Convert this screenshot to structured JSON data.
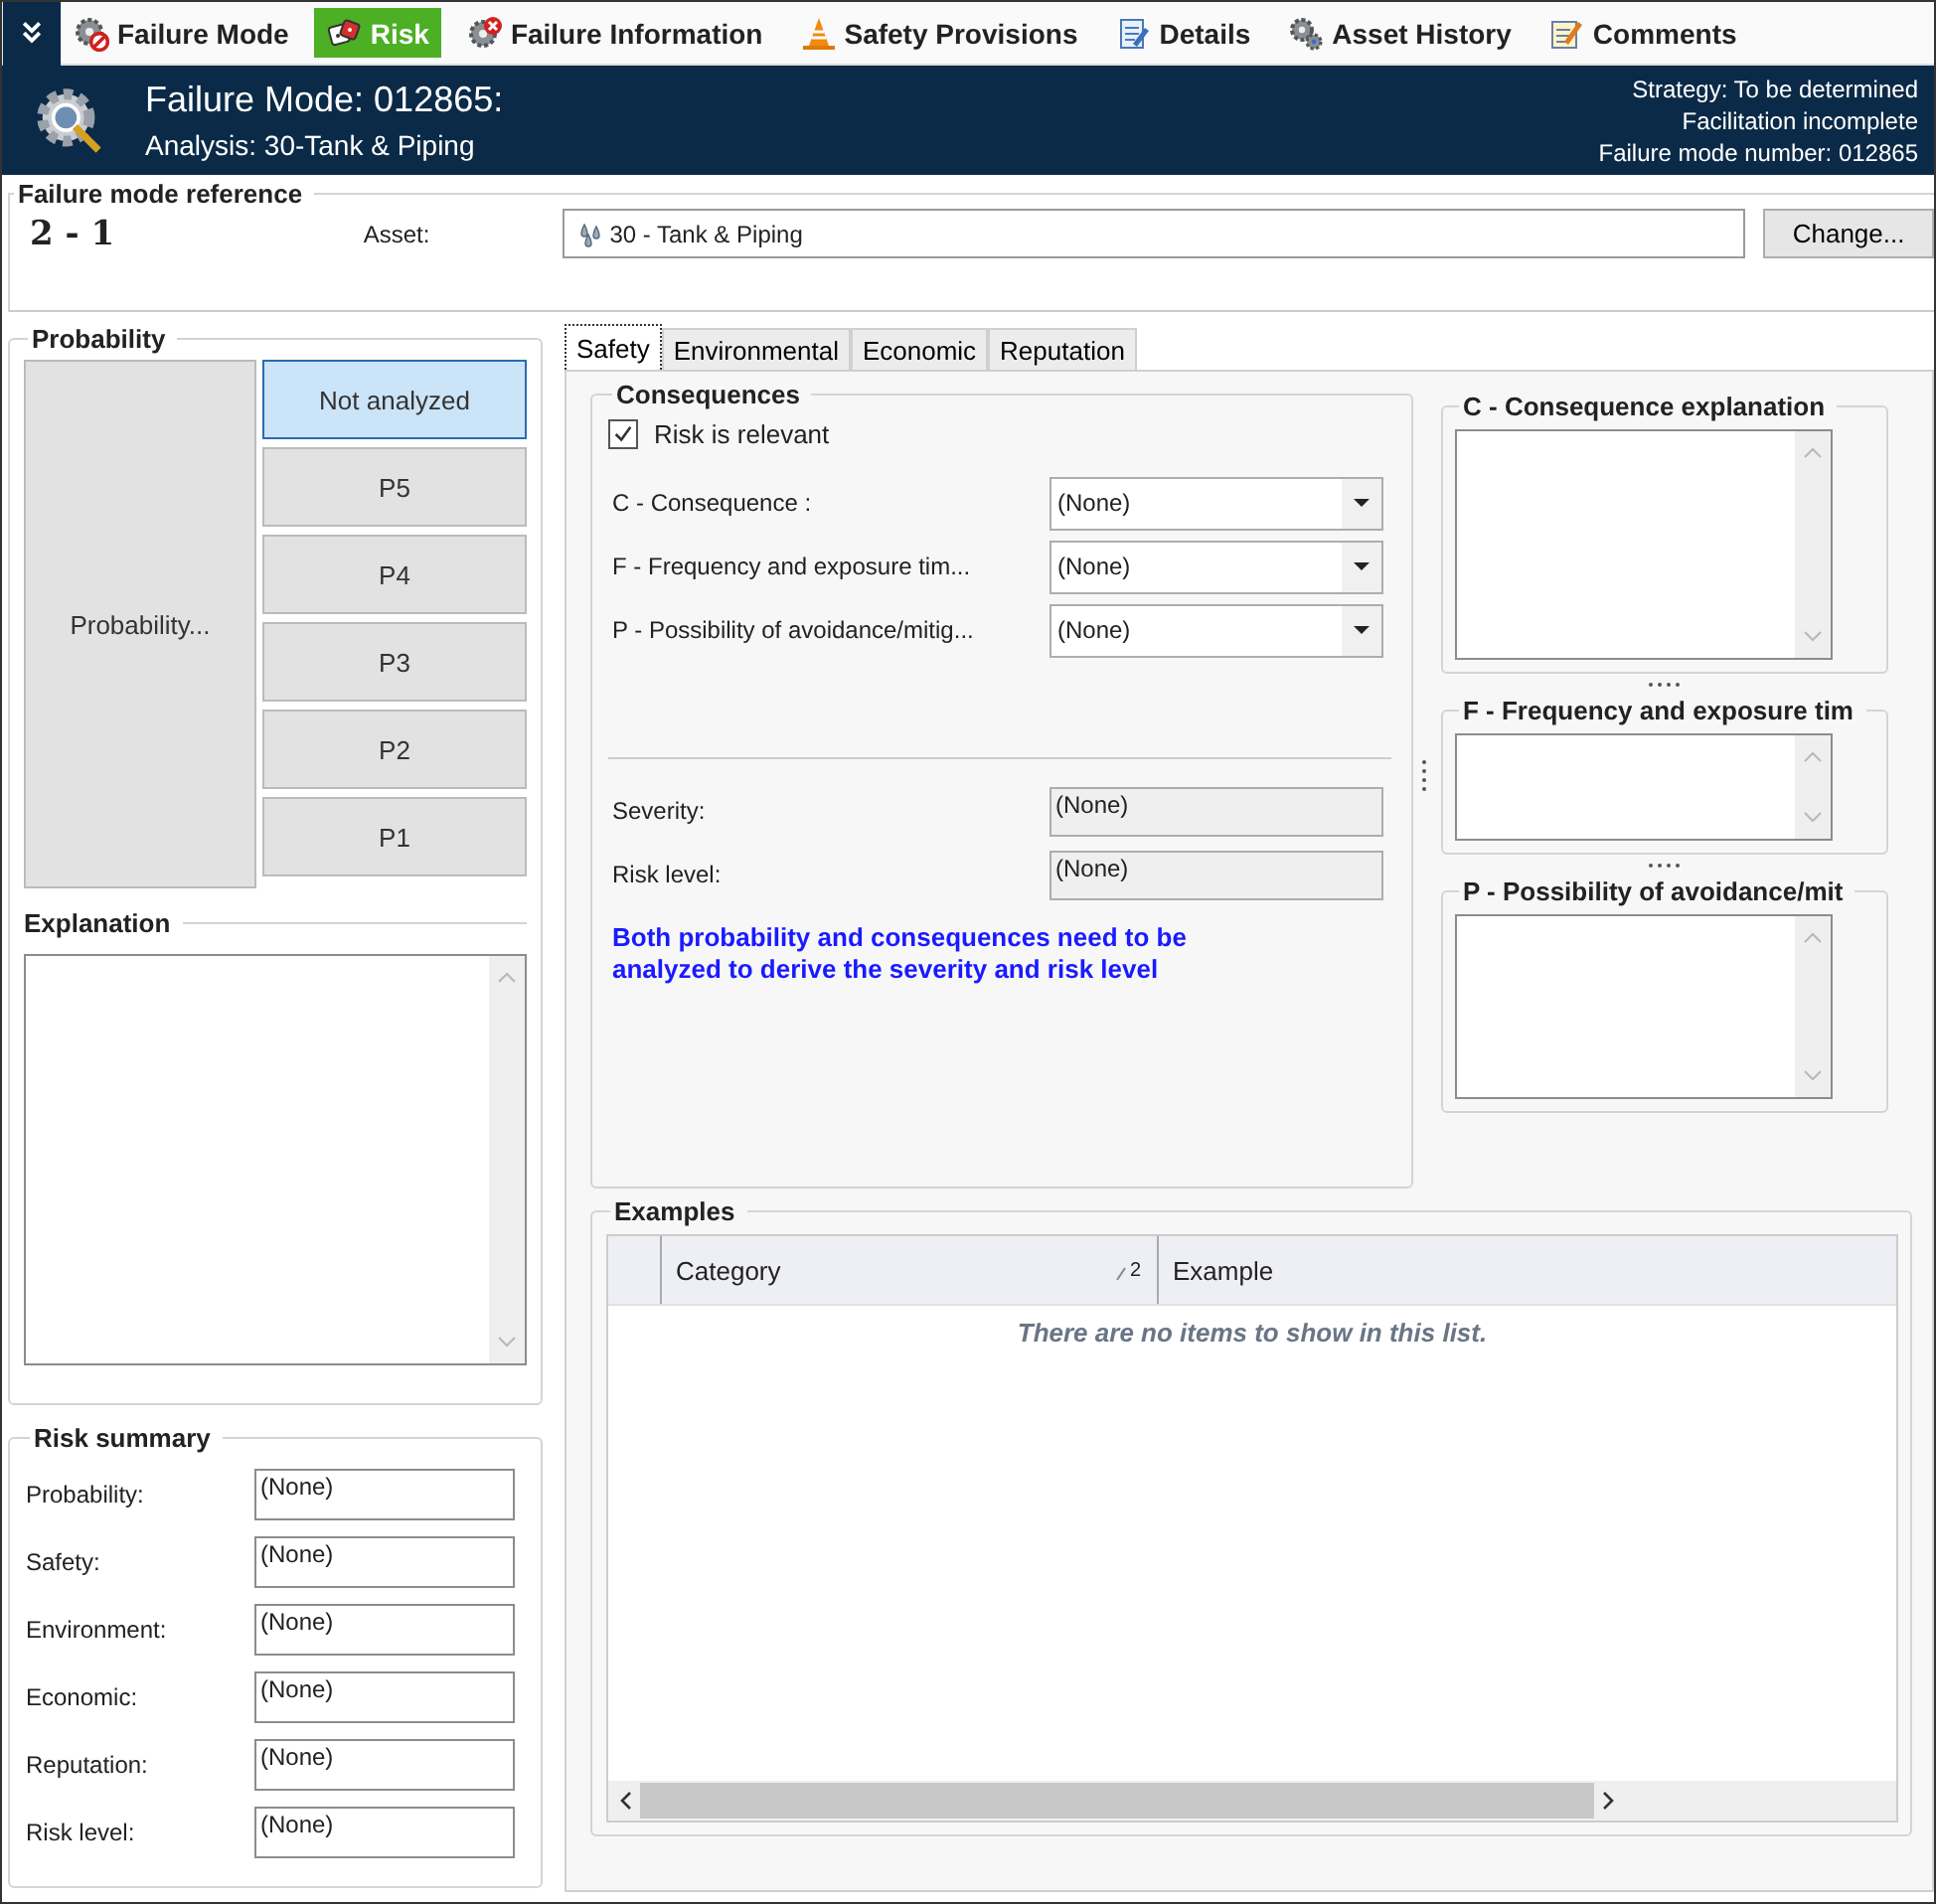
{
  "toolbar": {
    "tabs": [
      {
        "label": "Failure Mode",
        "selected": false
      },
      {
        "label": "Risk",
        "selected": true
      },
      {
        "label": "Failure Information",
        "selected": false
      },
      {
        "label": "Safety Provisions",
        "selected": false
      },
      {
        "label": "Details",
        "selected": false
      },
      {
        "label": "Asset History",
        "selected": false
      },
      {
        "label": "Comments",
        "selected": false
      }
    ]
  },
  "header": {
    "title": "Failure Mode: 012865:",
    "subtitle": "Analysis: 30-Tank & Piping",
    "status_lines": [
      "Strategy: To be determined",
      "Facilitation incomplete",
      "Failure mode number: 012865"
    ]
  },
  "reference": {
    "title": "Failure mode reference",
    "number": "2 - 1",
    "asset_label": "Asset:",
    "asset_value": "30 - Tank & Piping",
    "change_button": "Change..."
  },
  "probability": {
    "title": "Probability",
    "main_button": "Probability...",
    "levels": [
      {
        "label": "Not analyzed",
        "selected": true
      },
      {
        "label": "P5",
        "selected": false
      },
      {
        "label": "P4",
        "selected": false
      },
      {
        "label": "P3",
        "selected": false
      },
      {
        "label": "P2",
        "selected": false
      },
      {
        "label": "P1",
        "selected": false
      }
    ]
  },
  "explanation": {
    "title": "Explanation"
  },
  "risk_summary": {
    "title": "Risk summary",
    "rows": [
      {
        "label": "Probability:",
        "value": "(None)"
      },
      {
        "label": "Safety:",
        "value": "(None)"
      },
      {
        "label": "Environment:",
        "value": "(None)"
      },
      {
        "label": "Economic:",
        "value": "(None)"
      },
      {
        "label": "Reputation:",
        "value": "(None)"
      },
      {
        "label": "Risk level:",
        "value": "(None)"
      }
    ]
  },
  "detail_tabs": [
    {
      "label": "Safety",
      "selected": true
    },
    {
      "label": "Environmental",
      "selected": false
    },
    {
      "label": "Economic",
      "selected": false
    },
    {
      "label": "Reputation",
      "selected": false
    }
  ],
  "consequences": {
    "title": "Consequences",
    "risk_relevant": {
      "label": "Risk is relevant",
      "checked": true
    },
    "selects": [
      {
        "label": "C - Consequence :",
        "value": "(None)"
      },
      {
        "label": "F - Frequency and exposure tim...",
        "value": "(None)"
      },
      {
        "label": "P - Possibility of avoidance/mitig...",
        "value": "(None)"
      }
    ],
    "readouts": [
      {
        "label": "Severity:",
        "value": "(None)"
      },
      {
        "label": "Risk level:",
        "value": "(None)"
      }
    ],
    "note": "Both probability and consequences need to be analyzed to derive the severity and risk level"
  },
  "memos": [
    {
      "title": "C - Consequence explanation"
    },
    {
      "title": "F - Frequency and exposure tim"
    },
    {
      "title": "P - Possibility of avoidance/mit"
    }
  ],
  "examples": {
    "title": "Examples",
    "columns": [
      "Category",
      "Example"
    ],
    "sort_index": "2",
    "empty_text": "There are no items to show in this list."
  }
}
